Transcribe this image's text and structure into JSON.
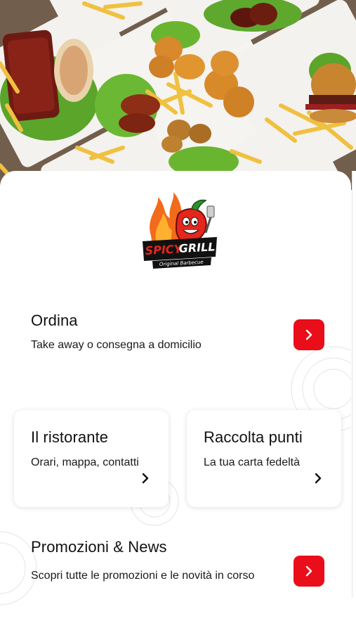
{
  "brand": {
    "logo_word_1": "SPICY",
    "logo_word_2": "GRILL",
    "logo_tagline": "Original Barbecue"
  },
  "order": {
    "title": "Ordina",
    "subtitle": "Take away o consegna a domicilio",
    "button_icon": "chevron-right-icon"
  },
  "cards": [
    {
      "title": "Il ristorante",
      "subtitle": "Orari, mappa, contatti",
      "icon": "chevron-right-icon"
    },
    {
      "title": "Raccolta punti",
      "subtitle": "La tua carta fedeltà",
      "icon": "chevron-right-icon"
    }
  ],
  "promo": {
    "title": "Promozioni & News",
    "subtitle": "Scopri tutte le promozioni e le novità in corso",
    "button_icon": "chevron-right-icon"
  },
  "colors": {
    "accent": "#ea0d1a",
    "text": "#111111",
    "background": "#ffffff"
  }
}
